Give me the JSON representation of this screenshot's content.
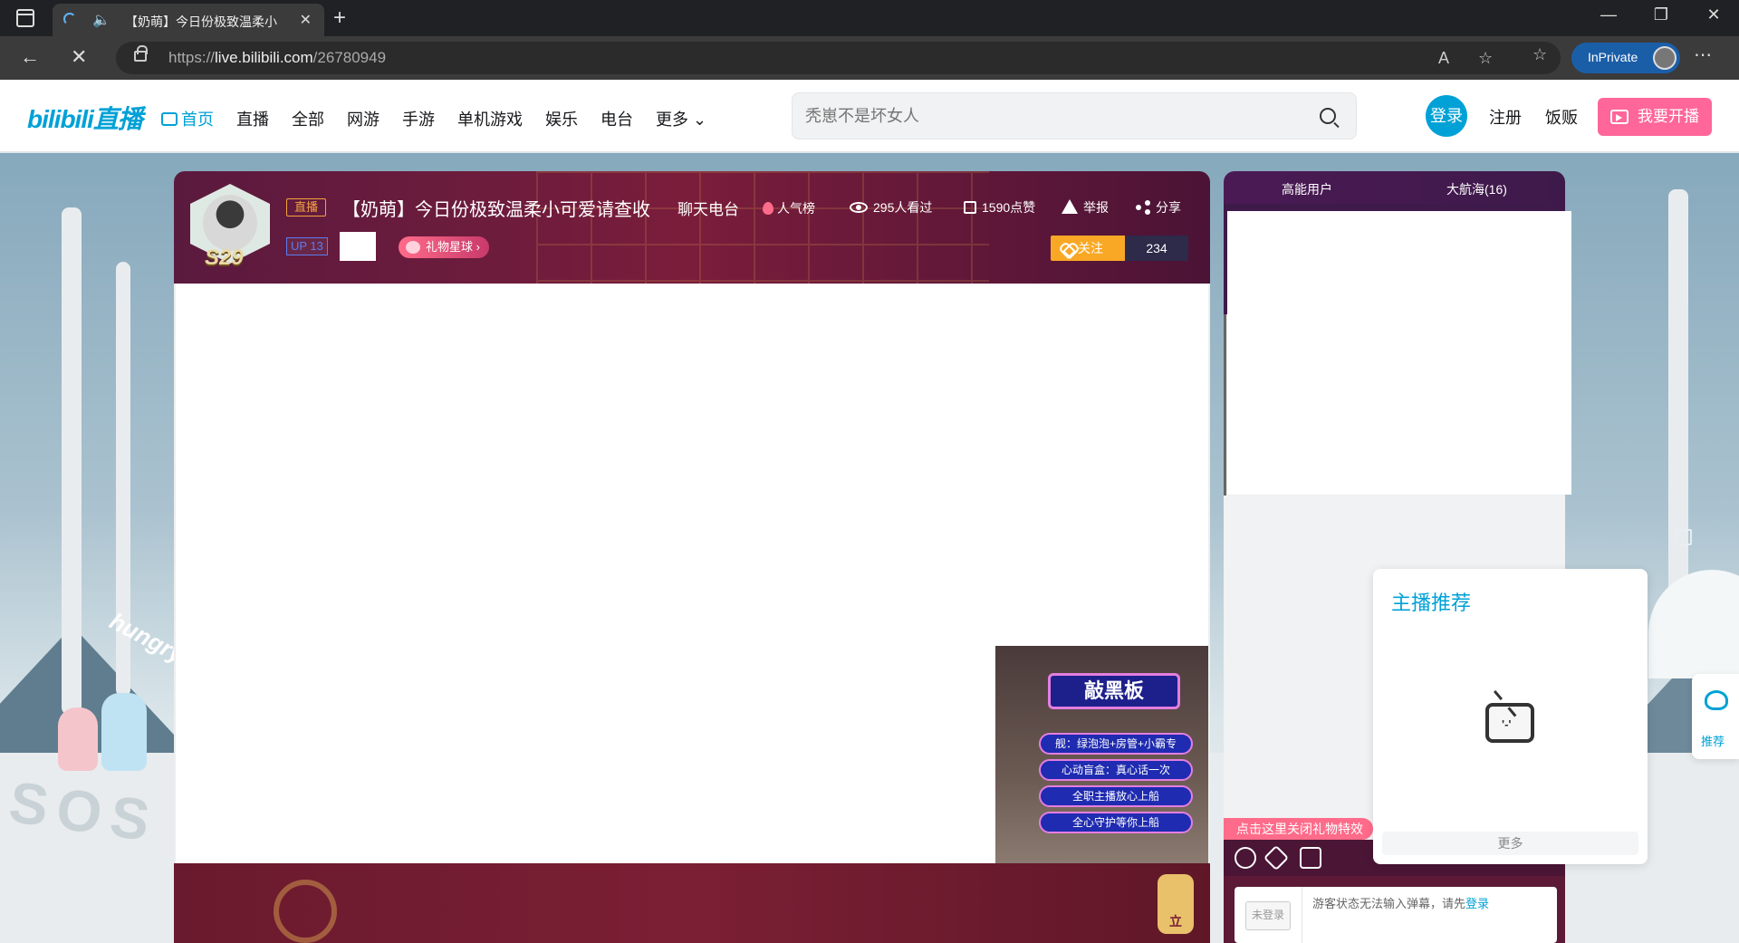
{
  "browser": {
    "tab_title": "【奶萌】今日份极致温柔小",
    "url_prefix": "https://",
    "url_host": "live.bilibili.com",
    "url_path": "/26780949",
    "inprivate_label": "InPrivate"
  },
  "header": {
    "logo": "bilibili直播",
    "nav": [
      "首页",
      "直播",
      "全部",
      "网游",
      "手游",
      "单机游戏",
      "娱乐",
      "电台",
      "更多"
    ],
    "search_placeholder": "秃崽不是坏女人",
    "login": "登录",
    "register": "注册",
    "fanfan": "饭贩",
    "go_live": "我要开播"
  },
  "room": {
    "live_tag": "直播",
    "title": "【奶萌】今日份极致温柔小可爱请查收",
    "area": "聊天电台",
    "rank_label": "人气榜",
    "watched": "295人看过",
    "likes": "1590点赞",
    "report": "举报",
    "share": "分享",
    "up_level": "UP 13",
    "avatar_badge": "S29",
    "gift_star": "礼物星球",
    "follow": "关注",
    "follow_count": "234"
  },
  "board": {
    "title": "敲黑板",
    "rows": [
      "舰：绿泡泡+房管+小霸专",
      "心动盲盒：真心话一次",
      "全职主播放心上船",
      "全心守护等你上船"
    ]
  },
  "bottom": {
    "lantern_text": "立"
  },
  "side": {
    "tab_high": "高能用户",
    "tab_guard": "大航海(16)",
    "gift_effect_toggle": "点击这里关闭礼物特效",
    "unlogged": "未登录",
    "chat_hint": "游客状态无法输入弹幕，请先",
    "chat_login": "登录"
  },
  "recommend": {
    "title": "主播推荐",
    "more": "更多",
    "side_label": "推荐"
  },
  "scene": {
    "hungry": "hungry",
    "sos": "SOS"
  }
}
